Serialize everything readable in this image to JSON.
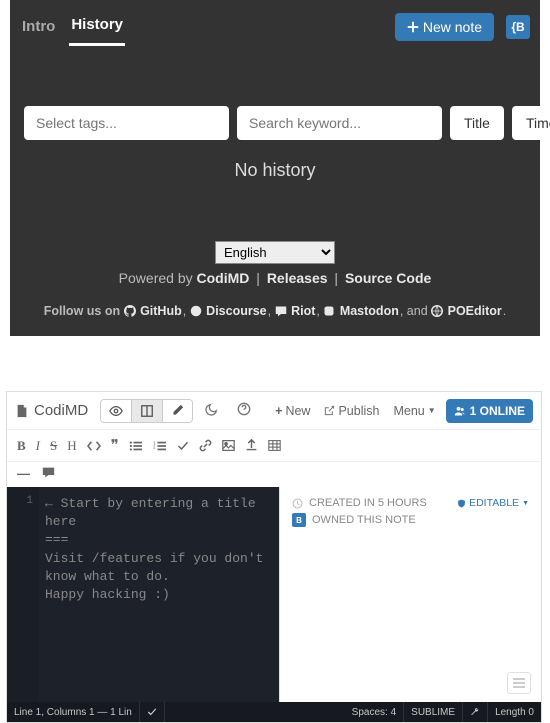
{
  "top": {
    "tabs": {
      "intro": "Intro",
      "history": "History"
    },
    "new_note": "New note",
    "tags_placeholder": "Select tags...",
    "search_placeholder": "Search keyword...",
    "title_btn": "Title",
    "time_btn": "Time",
    "no_history": "No history",
    "language": "English",
    "powered_prefix": "Powered by ",
    "brand": "CodiMD",
    "releases": "Releases",
    "source": "Source Code",
    "follow_prefix": "Follow us on ",
    "links": {
      "github": "GitHub",
      "discourse": "Discourse",
      "riot": "Riot",
      "mastodon": "Mastodon",
      "poeditor": "POEditor"
    },
    "and": ", and "
  },
  "editor": {
    "brand": "CodiMD",
    "new": "New",
    "publish": "Publish",
    "menu": "Menu",
    "online": "1 ONLINE",
    "created": "CREATED IN 5 HOURS",
    "owned": "OWNED THIS NOTE",
    "editable": "EDITABLE",
    "gutter_line": "1",
    "code_text": "← Start by entering a title here\n===\nVisit /features if you don't know what to do.\nHappy hacking :)",
    "status": {
      "pos": "Line 1, Columns 1 — 1 Lin",
      "spaces": "Spaces: 4",
      "keymap": "SUBLIME",
      "length": "Length 0"
    }
  }
}
